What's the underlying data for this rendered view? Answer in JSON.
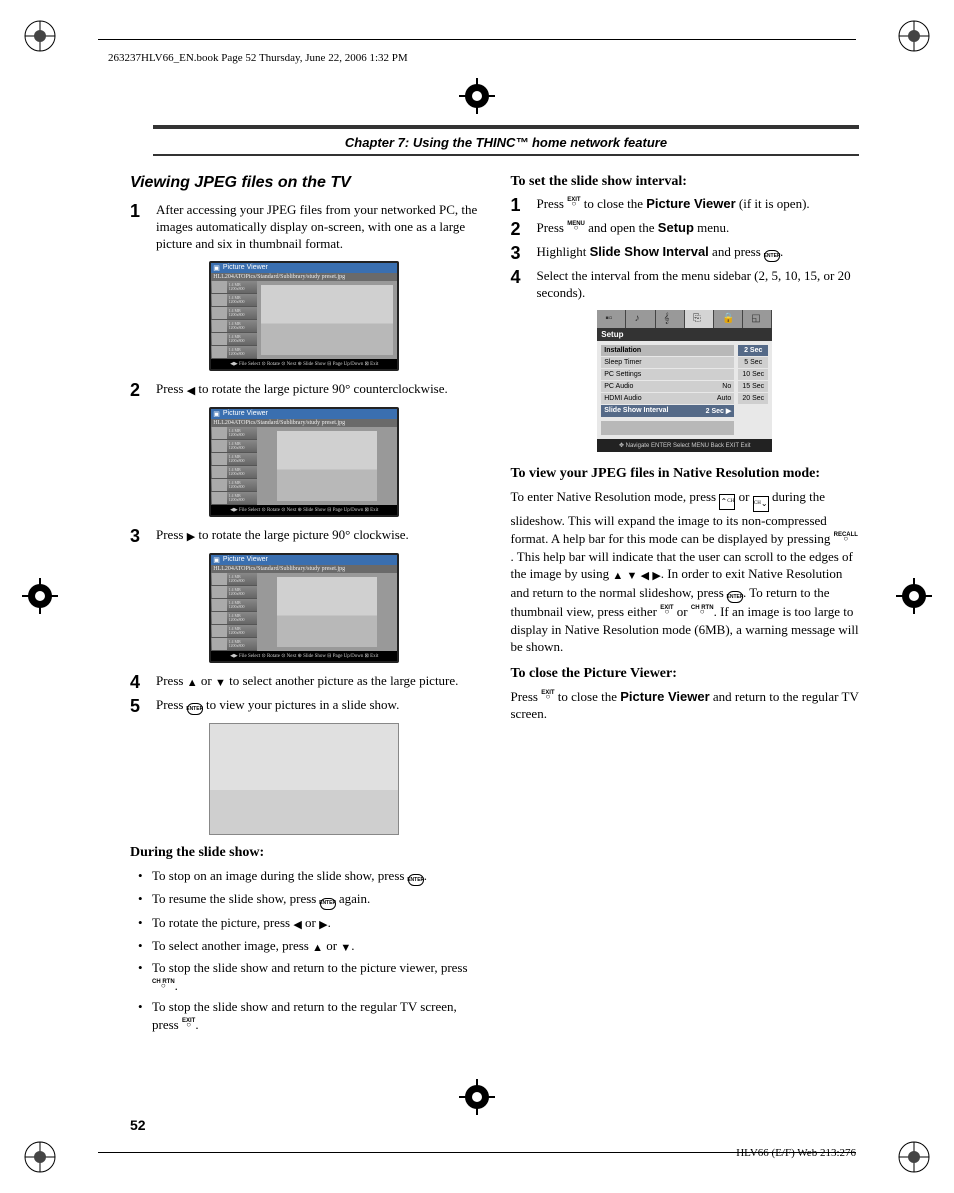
{
  "header_line": "263237HLV66_EN.book  Page 52  Thursday, June 22, 2006  1:32 PM",
  "chapter_title": "Chapter 7: Using the THINC™ home network feature",
  "section_title": "Viewing JPEG files on the TV",
  "steps_left": [
    "After accessing your JPEG files from your networked PC, the images automatically display on-screen, with one as a large picture and six in thumbnail format.",
    "Press ◀ to rotate the large picture 90° counterclockwise.",
    "Press ▶ to rotate the large picture 90° clockwise.",
    "Press ▲ or ▼ to select another picture as the large picture.",
    "Press ⊙ to view your pictures in a slide show."
  ],
  "pv": {
    "title": "Picture Viewer",
    "path": "HLL204ATOPics/Standard/Sublibrary/study preset.jpg",
    "thumbs": [
      "1.4 MB  1200x800",
      "1.4 MB  1200x800",
      "1.4 MB  1200x800",
      "1.4 MB  1200x800",
      "1.4 MB  1200x800",
      "1.4 MB  1200x800"
    ],
    "footer1": "◀▶ File Select   ⊙ Rotate   ⊙ Next   ⊕ Slide Show   ⊟ Page Up/Down   ⊠ Exit",
    "footer2": "◀▶ File Select   ⊙ Rotate   ⊙ Next   ⊕ Slide Show   ⊟ Page Up/Down   ⊠ Exit",
    "footer3": "◀▶ File Select   ⊙ Rotate   ⊙ Next   ⊕ Slide Show   ⊟ Page Up/Down   ⊠ Exit"
  },
  "during_title": "During the slide show:",
  "during_items": [
    "To stop on an image during the slide show, press ⊙.",
    "To resume the slide show, press ⊙ again.",
    "To rotate the picture, press ◀ or ▶.",
    "To select another image, press ▲ or ▼.",
    "To stop the slide show and return to the picture viewer, press CH RTN.",
    "To stop the slide show and return to the regular TV screen, press EXIT."
  ],
  "r1_title": "To set the slide show interval:",
  "r1_steps": [
    {
      "pre": "Press ",
      "btn": "EXIT",
      "mid": " to close the ",
      "bold": "Picture Viewer",
      "post": " (if it is open)."
    },
    {
      "pre": "Press ",
      "btn": "MENU",
      "mid": " and open the ",
      "bold": "Setup",
      "post": " menu."
    },
    {
      "pre": "Highlight ",
      "bold": "Slide Show Interval",
      "mid2": " and press ",
      "icon": "ENTER",
      "post": "."
    },
    {
      "plain": "Select the interval from the menu sidebar (2, 5, 10, 15, or 20 seconds)."
    }
  ],
  "setup": {
    "label": "Setup",
    "rows": [
      {
        "name": "Installation",
        "val": "",
        "header": true
      },
      {
        "name": "Sleep Timer",
        "val": ""
      },
      {
        "name": "PC Settings",
        "val": ""
      },
      {
        "name": "PC Audio",
        "val": "No"
      },
      {
        "name": "HDMI Audio",
        "val": "Auto"
      },
      {
        "name": "Slide Show Interval",
        "val": "2 Sec ▶",
        "sel": true
      }
    ],
    "opts": [
      {
        "label": "2 Sec",
        "sel": true
      },
      {
        "label": "5 Sec"
      },
      {
        "label": "10 Sec"
      },
      {
        "label": "15 Sec"
      },
      {
        "label": "20 Sec"
      }
    ],
    "nav": "✥ Navigate   ENTER Select   MENU Back   EXIT Exit"
  },
  "r2_title": "To view your JPEG files in Native Resolution mode:",
  "r2_para": "To enter Native Resolution mode, press [CH▲] or [CH▼] during the slideshow. This will expand the image to its non-compressed format. A help bar for this mode can be displayed by pressing RECALL. This help bar will indicate that the user can scroll to the edges of the image by using ▲ ▼ ◀ ▶. In order to exit Native Resolution and return to the normal slideshow, press ⊙. To return to the thumbnail view, press either EXIT or CH RTN. If an image is too large to display in Native Resolution mode (6MB), a warning message will be shown.",
  "r3_title": "To close the Picture Viewer:",
  "r3_para_pre": "Press ",
  "r3_btn": "EXIT",
  "r3_para_mid": " to close the ",
  "r3_bold": "Picture Viewer",
  "r3_para_post": " and return to the regular TV screen.",
  "page_num": "52",
  "footer_id": "HLV66 (E/F) Web 213:276"
}
